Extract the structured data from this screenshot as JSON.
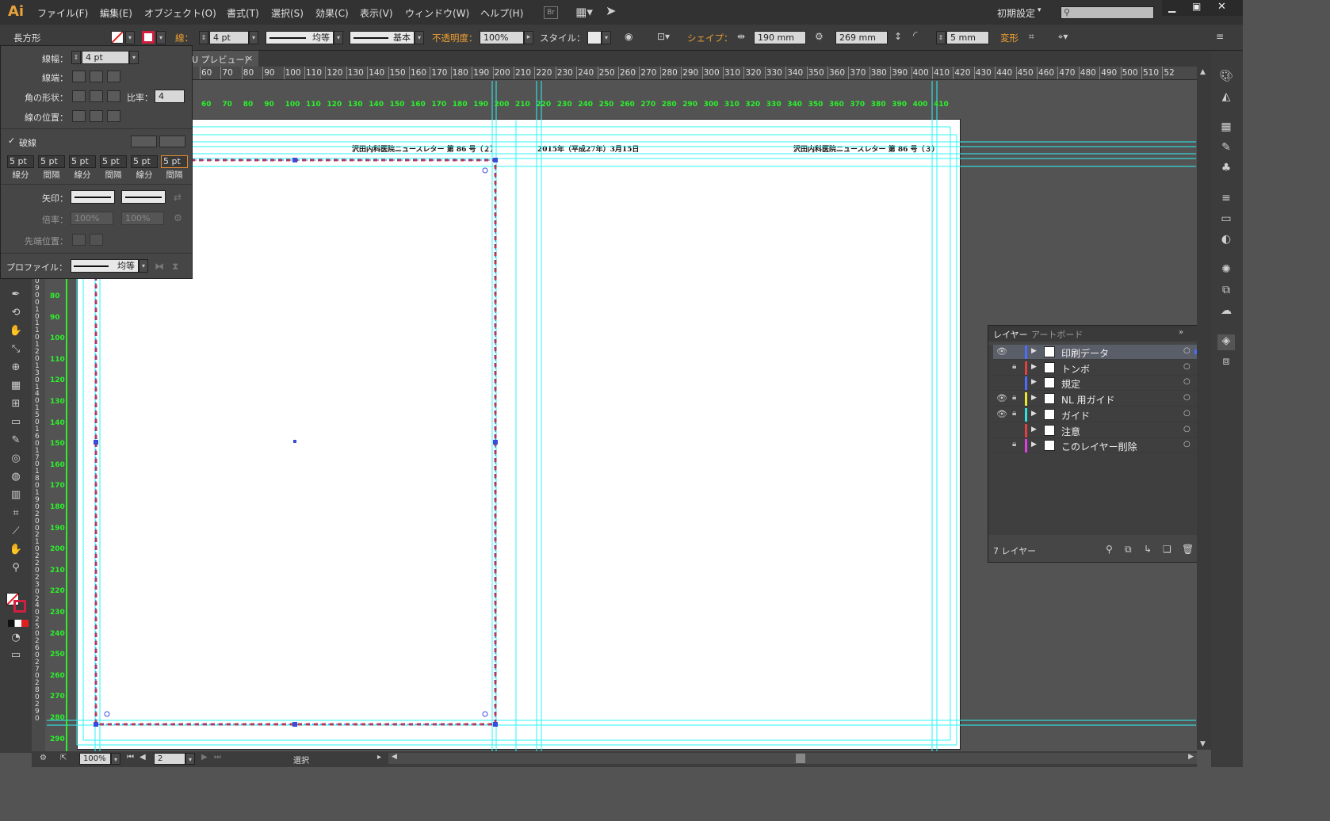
{
  "app": {
    "logo": "Ai",
    "workspace": "初期設定",
    "workspace_arrow": "▾"
  },
  "menu": [
    "ファイル(F)",
    "編集(E)",
    "オブジェクト(O)",
    "書式(T)",
    "選択(S)",
    "効果(C)",
    "表示(V)",
    "ウィンドウ(W)",
    "ヘルプ(H)"
  ],
  "menu_extra": {
    "bridge": "Br"
  },
  "control": {
    "object_type": "長方形",
    "stroke_label": "線：",
    "stroke_weight": "4 pt",
    "variable_width": "均等",
    "brush": "基本",
    "opacity_label": "不透明度：",
    "opacity": "100%",
    "style_label": "スタイル：",
    "shape_label": "シェイプ：",
    "width": "190 mm",
    "height": "269 mm",
    "corner": "5 mm",
    "transform_label": "変形"
  },
  "doc_tab": {
    "label": "U プレビュー)",
    "close": "×"
  },
  "stroke_panel": {
    "weight_label": "線幅：",
    "weight": "4 pt",
    "cap_label": "線端：",
    "join_label": "角の形状：",
    "limit_label": "比率：",
    "limit": "4",
    "align_label": "線の位置：",
    "dashed_label": "破線",
    "dashed": true,
    "dash_values": [
      "5 pt",
      "5 pt",
      "5 pt",
      "5 pt",
      "5 pt",
      "5 pt"
    ],
    "dash_labels": [
      "線分",
      "間隔",
      "線分",
      "間隔",
      "線分",
      "間隔"
    ],
    "arrow_label": "矢印：",
    "scale_label": "倍率：",
    "scale1": "100%",
    "scale2": "100%",
    "tip_label": "先端位置：",
    "profile_label": "プロファイル：",
    "profile": "均等"
  },
  "ruler": {
    "top": [
      "60",
      "70",
      "80",
      "90",
      "100",
      "110",
      "120",
      "130",
      "140",
      "150",
      "160",
      "170",
      "180",
      "190",
      "200",
      "210",
      "220",
      "230",
      "240",
      "250",
      "260",
      "270",
      "280",
      "290",
      "300",
      "310",
      "320",
      "330",
      "340",
      "350",
      "360",
      "370",
      "380",
      "390",
      "400",
      "410",
      "420",
      "430",
      "440",
      "450",
      "460",
      "470",
      "480",
      "490",
      "500",
      "510",
      "52"
    ],
    "green_top": [
      "60",
      "70",
      "80",
      "90",
      "100",
      "110",
      "120",
      "130",
      "140",
      "150",
      "160",
      "170",
      "180",
      "190",
      "200",
      "210",
      "220",
      "230",
      "240",
      "250",
      "260",
      "270",
      "280",
      "290",
      "300",
      "310",
      "320",
      "330",
      "340",
      "350",
      "360",
      "370",
      "380",
      "390",
      "400",
      "410"
    ],
    "green_left": [
      "80",
      "90",
      "100",
      "110",
      "120",
      "130",
      "140",
      "150",
      "160",
      "170",
      "180",
      "190",
      "200",
      "210",
      "220",
      "230",
      "240",
      "250",
      "260",
      "270",
      "280",
      "290"
    ],
    "left_digits": [
      "0",
      "9",
      "0",
      "0",
      "1",
      "0",
      "1",
      "1",
      "0",
      "1",
      "2",
      "0",
      "1",
      "3",
      "0",
      "1",
      "4",
      "0",
      "1",
      "5",
      "0",
      "1",
      "6",
      "0",
      "1",
      "7",
      "0",
      "1",
      "8",
      "0",
      "1",
      "9",
      "0",
      "2",
      "0",
      "0",
      "2",
      "1",
      "0",
      "2",
      "2",
      "0",
      "2",
      "3",
      "0",
      "2",
      "4",
      "0",
      "2",
      "5",
      "0",
      "2",
      "6",
      "0",
      "2",
      "7",
      "0",
      "2",
      "8",
      "0",
      "2",
      "9",
      "0"
    ]
  },
  "artboard": {
    "header_left": "沢田内科医院ニュースレター 第 86 号（２）",
    "header_date": "2015年（平成27年）3月15日",
    "header_right": "沢田内科医院ニュースレター 第 86 号（３）"
  },
  "layers_panel": {
    "tabs": [
      "レイヤー",
      "アートボード"
    ],
    "layers": [
      {
        "name": "印刷データ",
        "color": "#4a6cff",
        "visible": true,
        "locked": false,
        "selected": true
      },
      {
        "name": "トンボ",
        "color": "#e04040",
        "visible": false,
        "locked": true,
        "selected": false
      },
      {
        "name": "規定",
        "color": "#4a6cff",
        "visible": false,
        "locked": false,
        "selected": false
      },
      {
        "name": "NL 用ガイド",
        "color": "#e8e830",
        "visible": true,
        "locked": true,
        "selected": false
      },
      {
        "name": "ガイド",
        "color": "#30e0e0",
        "visible": true,
        "locked": true,
        "selected": false
      },
      {
        "name": "注意",
        "color": "#e04040",
        "visible": false,
        "locked": false,
        "selected": false
      },
      {
        "name": "このレイヤー削除",
        "color": "#e040e0",
        "visible": false,
        "locked": true,
        "selected": false
      }
    ],
    "count": "7 レイヤー"
  },
  "status": {
    "zoom": "100%",
    "artboard": "2",
    "tool": "選択"
  },
  "icons": {
    "search": "search-icon",
    "send": "paper-plane-icon",
    "arrange": "arrange-documents-icon"
  },
  "colors": {
    "guide": "#2ff5f5",
    "selection": "#3a4bd8",
    "dash_stroke": "#c0394a",
    "accent": "#f0a030"
  }
}
